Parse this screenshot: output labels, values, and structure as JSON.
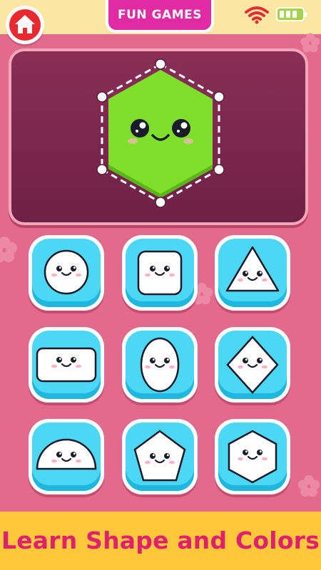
{
  "header": {
    "home_icon": "home-icon",
    "title": "FUN GAMES",
    "status_icons": [
      "wifi-icon",
      "battery-icon"
    ]
  },
  "puzzle": {
    "target_shape": "hexagon",
    "target_color": "#7ee02a"
  },
  "shape_options": [
    {
      "shape": "circle"
    },
    {
      "shape": "square"
    },
    {
      "shape": "triangle"
    },
    {
      "shape": "rectangle"
    },
    {
      "shape": "oval"
    },
    {
      "shape": "diamond"
    },
    {
      "shape": "semicircle"
    },
    {
      "shape": "pentagon"
    },
    {
      "shape": "hexagon"
    }
  ],
  "footer": {
    "caption": "Learn Shape and Colors"
  },
  "colors": {
    "background": "#e26a8c",
    "top_bar": "#fbe7a4",
    "title_pill": "#e02ba2",
    "home_button": "#e9292f",
    "tile": "#4cd8f5",
    "banner": "#ffc83a",
    "banner_text": "#e0206f"
  }
}
